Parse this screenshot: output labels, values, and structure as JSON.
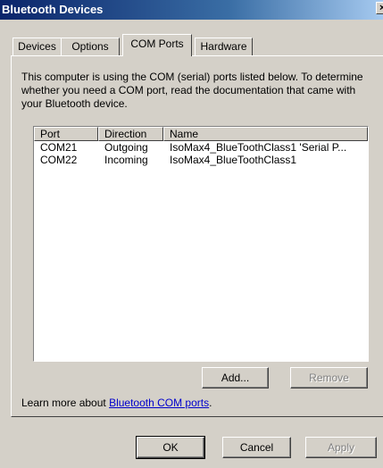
{
  "window": {
    "title": "Bluetooth Devices",
    "close_glyph": "×"
  },
  "tabs": [
    "Devices",
    "Options",
    "COM Ports",
    "Hardware"
  ],
  "description": "This computer is using the COM (serial) ports listed below. To determine whether you need a COM port, read the documentation that came with your Bluetooth device.",
  "table": {
    "columns": [
      "Port",
      "Direction",
      "Name"
    ],
    "rows": [
      {
        "port": "COM21",
        "direction": "Outgoing",
        "name": "IsoMax4_BlueToothClass1 'Serial P..."
      },
      {
        "port": "COM22",
        "direction": "Incoming",
        "name": "IsoMax4_BlueToothClass1"
      }
    ]
  },
  "actions": {
    "add": "Add...",
    "remove": "Remove"
  },
  "learn": {
    "prefix": "Learn more about ",
    "link": "Bluetooth COM ports",
    "suffix": "."
  },
  "footer": {
    "ok": "OK",
    "cancel": "Cancel",
    "apply": "Apply"
  }
}
